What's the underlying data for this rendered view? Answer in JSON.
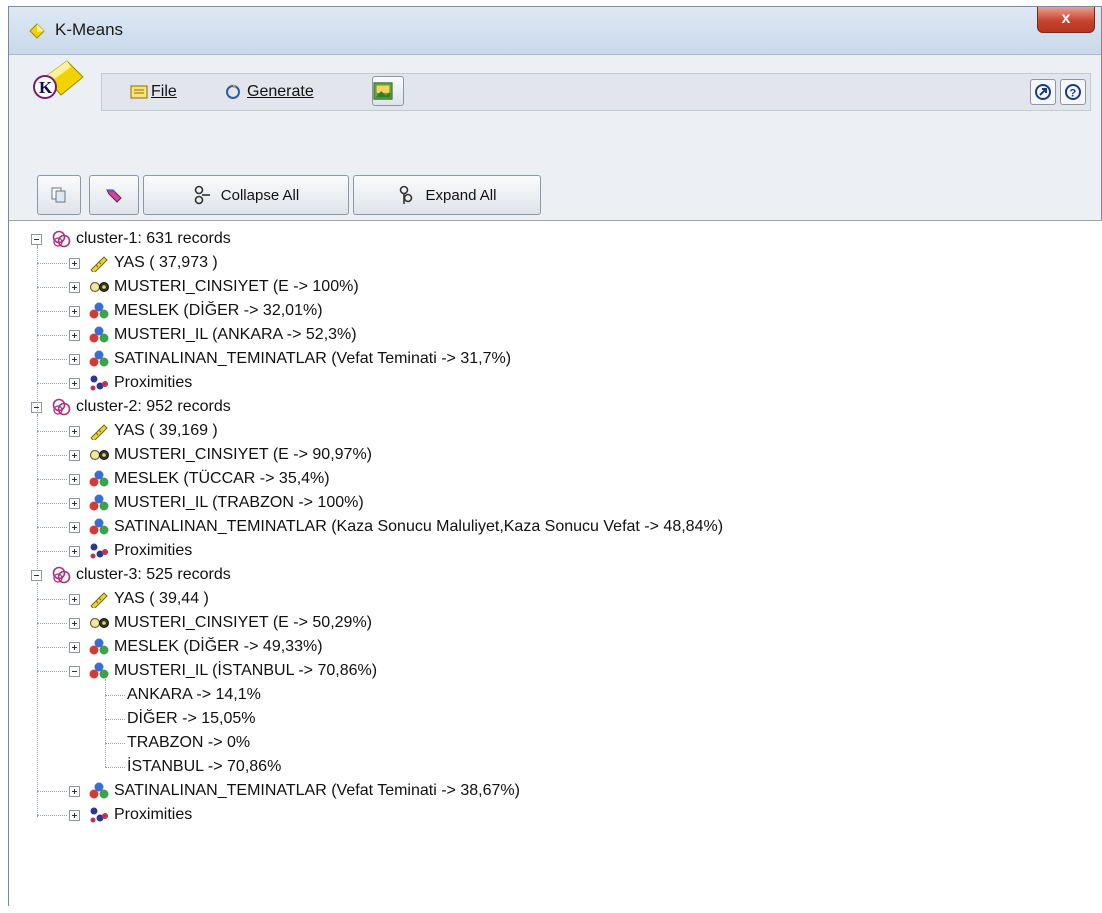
{
  "window": {
    "title": "K-Means",
    "close_label": "x"
  },
  "menu": {
    "file": "File",
    "generate": "Generate"
  },
  "toolbar": {
    "collapse_all": "Collapse All",
    "expand_all": "Expand All"
  },
  "tree": {
    "clusters": [
      {
        "label": "cluster-1: 631 records",
        "children": [
          "YAS ( 37,973 )",
          "MUSTERI_CINSIYET (E -> 100%)",
          "MESLEK (DİĞER -> 32,01%)",
          "MUSTERI_IL (ANKARA -> 52,3%)",
          "SATINALINAN_TEMINATLAR (Vefat Teminati -> 31,7%)",
          "Proximities"
        ]
      },
      {
        "label": "cluster-2: 952 records",
        "children": [
          "YAS ( 39,169 )",
          "MUSTERI_CINSIYET (E -> 90,97%)",
          "MESLEK (TÜCCAR -> 35,4%)",
          "MUSTERI_IL (TRABZON -> 100%)",
          "SATINALINAN_TEMINATLAR (Kaza Sonucu Maluliyet,Kaza Sonucu Vefat -> 48,84%)",
          "Proximities"
        ]
      },
      {
        "label": "cluster-3: 525 records",
        "children": [
          "YAS ( 39,44 )",
          "MUSTERI_CINSIYET (E -> 50,29%)",
          "MESLEK (DİĞER -> 49,33%)",
          "MUSTERI_IL (İSTANBUL -> 70,86%)",
          "SATINALINAN_TEMINATLAR (Vefat Teminati -> 38,67%)",
          "Proximities"
        ],
        "expanded_il": [
          "ANKARA -> 14,1%",
          "DİĞER -> 15,05%",
          "TRABZON -> 0%",
          "İSTANBUL -> 70,86%"
        ]
      }
    ]
  },
  "icons": {
    "title": "diamond-icon",
    "logo": "kmeans-logo-icon",
    "cluster": "cluster-icon",
    "range": "ruler-icon",
    "flag": "flag-binary-icon",
    "set": "set-icon",
    "proximities": "proximities-icon"
  }
}
